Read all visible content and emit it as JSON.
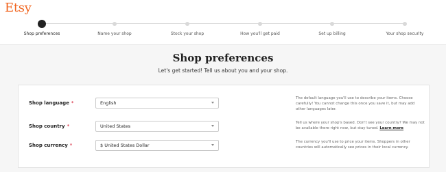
{
  "brand": {
    "name": "Etsy",
    "color": "#f1641e"
  },
  "steps": [
    {
      "label": "Shop preferences",
      "active": true
    },
    {
      "label": "Name your shop",
      "active": false
    },
    {
      "label": "Stock your shop",
      "active": false
    },
    {
      "label": "How you'll get paid",
      "active": false
    },
    {
      "label": "Set up billing",
      "active": false
    },
    {
      "label": "Your shop security",
      "active": false
    }
  ],
  "page": {
    "title": "Shop preferences",
    "subtitle": "Let's get started! Tell us about you and your shop."
  },
  "fields": {
    "language": {
      "label": "Shop language",
      "required": "*",
      "value": "English",
      "help": "The default language you'll use to describe your items. Choose carefully! You cannot change this once you save it, but may add other languages later."
    },
    "country": {
      "label": "Shop country",
      "required": "*",
      "value": "United States",
      "help": "Tell us where your shop's based. Don't see your country? We may not be available there right now, but stay tuned.",
      "help_link": "Learn more"
    },
    "currency": {
      "label": "Shop currency",
      "required": "*",
      "value": "$ United States Dollar",
      "help": "The currency you'll use to price your items. Shoppers in other countries will automatically see prices in their local currency."
    }
  },
  "colors": {
    "active_step": "#222222",
    "inactive_step": "#d9d9d9",
    "required": "#d0021b"
  }
}
